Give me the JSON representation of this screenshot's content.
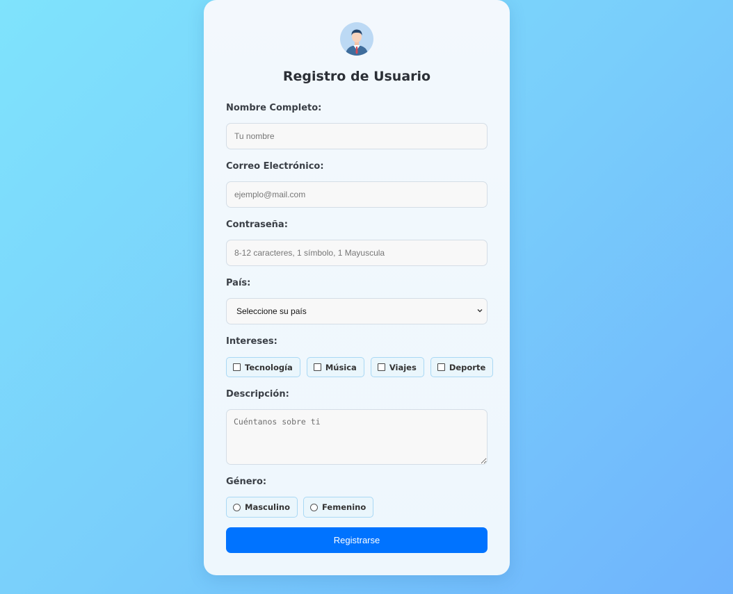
{
  "form": {
    "title": "Registro de Usuario",
    "avatar_icon": "user-avatar-icon",
    "name": {
      "label": "Nombre Completo:",
      "placeholder": "Tu nombre",
      "value": ""
    },
    "email": {
      "label": "Correo Electrónico:",
      "placeholder": "ejemplo@mail.com",
      "value": ""
    },
    "password": {
      "label": "Contraseña:",
      "placeholder": "8-12 caracteres, 1 símbolo, 1 Mayuscula",
      "value": ""
    },
    "country": {
      "label": "País:",
      "selected": "Seleccione su país"
    },
    "interests": {
      "label": "Intereses:",
      "options": [
        {
          "label": "Tecnología",
          "checked": false
        },
        {
          "label": "Música",
          "checked": false
        },
        {
          "label": "Viajes",
          "checked": false
        },
        {
          "label": "Deporte",
          "checked": false
        }
      ]
    },
    "description": {
      "label": "Descripción:",
      "placeholder": "Cuéntanos sobre ti"
    },
    "gender": {
      "label": "Género:",
      "options": [
        {
          "label": "Masculino",
          "selected": false
        },
        {
          "label": "Femenino",
          "selected": false
        }
      ]
    },
    "submit_label": "Registrarse"
  },
  "colors": {
    "accent": "#0073ff",
    "chip_border": "#a9d8f4",
    "background_start": "#7fe3fc",
    "background_end": "#6fb3fc"
  }
}
